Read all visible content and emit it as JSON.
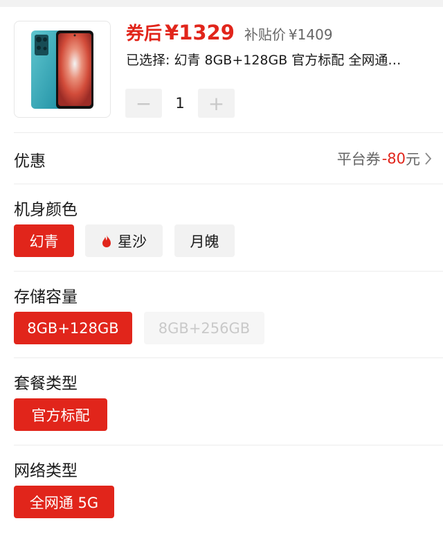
{
  "product": {
    "coupon_price_prefix": "券后",
    "coupon_price": "¥1329",
    "original_price_label": "补贴价",
    "original_price": "¥1409",
    "selected_summary": "已选择: 幻青 8GB+128GB 官方标配 全网通…",
    "quantity": "1",
    "decrement_label": "−",
    "increment_label": "+"
  },
  "coupon": {
    "title": "优惠",
    "label": "平台券",
    "value": "-80",
    "unit": "元"
  },
  "color": {
    "title": "机身颜色",
    "options": [
      {
        "label": "幻青",
        "state": "selected"
      },
      {
        "label": "星沙",
        "state": "normal",
        "icon": "flame-icon"
      },
      {
        "label": "月魄",
        "state": "normal"
      }
    ]
  },
  "storage": {
    "title": "存储容量",
    "options": [
      {
        "label": "8GB+128GB",
        "state": "selected"
      },
      {
        "label": "8GB+256GB",
        "state": "disabled"
      }
    ]
  },
  "package": {
    "title": "套餐类型",
    "options": [
      {
        "label": "官方标配",
        "state": "selected"
      }
    ]
  },
  "network": {
    "title": "网络类型",
    "options": [
      {
        "label": "全网通 5G",
        "state": "selected"
      }
    ]
  },
  "colors": {
    "accent": "#e1251b",
    "chip_bg": "#f2f2f2",
    "muted_text": "#666666",
    "disabled_text": "#c9c9c9"
  }
}
